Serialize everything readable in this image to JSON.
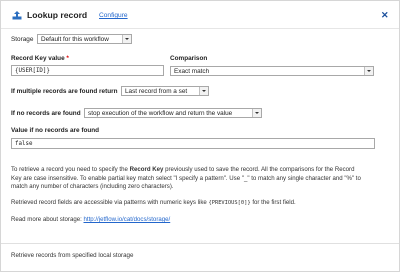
{
  "header": {
    "title": "Lookup record",
    "configure_link": "Configure",
    "close_icon": "close-icon"
  },
  "storage": {
    "label": "Storage",
    "selected": "Default for this workflow"
  },
  "record_key": {
    "label": "Record Key value",
    "required_mark": "*",
    "value": "{USER[ID]}"
  },
  "comparison": {
    "label": "Comparison",
    "selected": "Exact match"
  },
  "multiple_found": {
    "label": "If multiple records are found return",
    "selected": "Last record from a set"
  },
  "none_found": {
    "label": "If no records are found",
    "selected": "stop execution of the workflow and return the value"
  },
  "value_if_none": {
    "label": "Value if no records are found",
    "value": "false"
  },
  "help": {
    "p1_a": "To retrieve a record you need to specify the ",
    "p1_bold": "Record Key",
    "p1_b": " previously used to save the record. All the comparisons for the Record",
    "p1_line2": "Key are case insensitive. To enable partial key match select \"I specify a pattern\". Use \"_\" to match any single character and \"%\" to",
    "p1_line3": "match any number of characters (including zero characters).",
    "p2_a": "Retrieved record fields are accessible via patterns with numeric keys like ",
    "p2_code": "{PREVIOUS[0]}",
    "p2_b": " for the first field.",
    "p3_a": "Read more about storage: ",
    "p3_link": "http://jetflow.io/cat/docs/storage/"
  },
  "footer": {
    "text": "Retrieve records from specified local storage"
  },
  "colors": {
    "link": "#2266cc",
    "close": "#1a4f9c",
    "header_icon": "#2c6fc0"
  }
}
